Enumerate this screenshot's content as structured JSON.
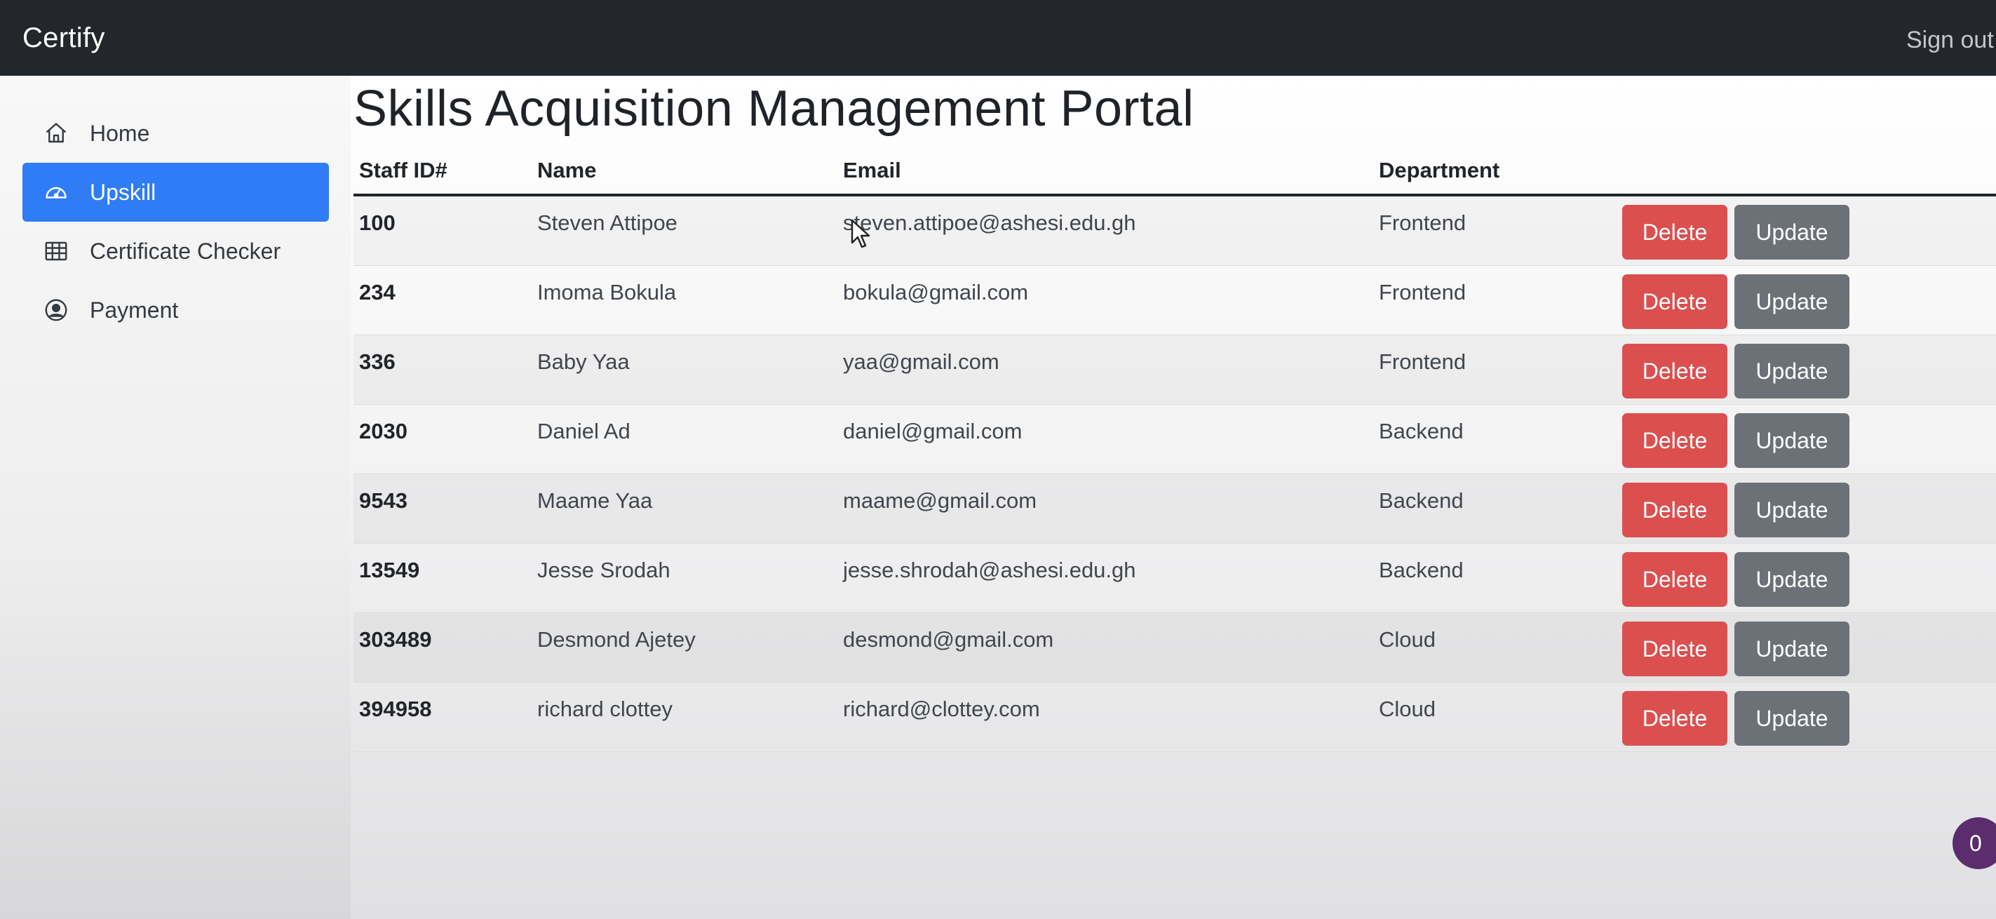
{
  "navbar": {
    "brand": "Certify",
    "signout": "Sign out"
  },
  "sidebar": {
    "items": [
      {
        "label": "Home",
        "icon": "house-icon",
        "active": false
      },
      {
        "label": "Upskill",
        "icon": "speedometer-icon",
        "active": true
      },
      {
        "label": "Certificate Checker",
        "icon": "table-icon",
        "active": false
      },
      {
        "label": "Payment",
        "icon": "person-circle-icon",
        "active": false
      }
    ]
  },
  "main": {
    "title": "Skills Acquisition Management Portal",
    "table": {
      "headers": [
        "Staff ID#",
        "Name",
        "Email",
        "Department"
      ],
      "rows": [
        {
          "id": "100",
          "name": "Steven Attipoe",
          "email": "steven.attipoe@ashesi.edu.gh",
          "department": "Frontend"
        },
        {
          "id": "234",
          "name": "Imoma Bokula",
          "email": "bokula@gmail.com",
          "department": "Frontend"
        },
        {
          "id": "336",
          "name": "Baby Yaa",
          "email": "yaa@gmail.com",
          "department": "Frontend"
        },
        {
          "id": "2030",
          "name": "Daniel Ad",
          "email": "daniel@gmail.com",
          "department": "Backend"
        },
        {
          "id": "9543",
          "name": "Maame Yaa",
          "email": "maame@gmail.com",
          "department": "Backend"
        },
        {
          "id": "13549",
          "name": "Jesse Srodah",
          "email": "jesse.shrodah@ashesi.edu.gh",
          "department": "Backend"
        },
        {
          "id": "303489",
          "name": "Desmond Ajetey",
          "email": "desmond@gmail.com",
          "department": "Cloud"
        },
        {
          "id": "394958",
          "name": "richard clottey",
          "email": "richard@clottey.com",
          "department": "Cloud"
        }
      ],
      "delete_label": "Delete",
      "update_label": "Update"
    }
  },
  "badge": {
    "count": "0"
  },
  "colors": {
    "navbar_bg": "#23272b",
    "active_nav": "#2f7cf6",
    "delete_btn": "#dc4f4f",
    "update_btn": "#6b7177",
    "badge_bg": "#5b2d6e"
  }
}
